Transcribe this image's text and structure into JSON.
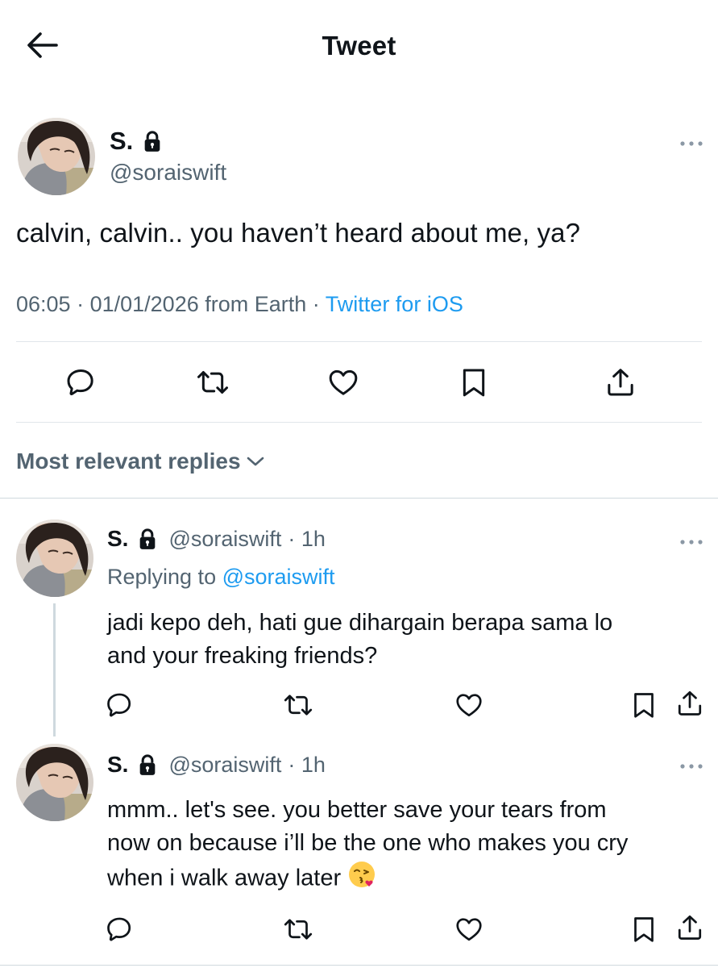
{
  "header": {
    "title": "Tweet",
    "back_icon": "arrow-left-icon"
  },
  "main_tweet": {
    "display_name": "S.",
    "handle": "@soraiswift",
    "text": "calvin, calvin.. you haven’t heard about me, ya?",
    "time": "06:05",
    "date": "01/01/2026 from Earth",
    "source": "Twitter for iOS",
    "actions": [
      "reply-icon",
      "retweet-icon",
      "like-icon",
      "bookmark-icon",
      "share-icon"
    ]
  },
  "replies_section": {
    "sort_label": "Most relevant replies"
  },
  "replies": [
    {
      "display_name": "S.",
      "handle": "@soraiswift",
      "time": "· 1h",
      "replying_to_label": "Replying to",
      "replying_to_handle": "@soraiswift",
      "text_line1": "jadi kepo deh, hati gue dihargain berapa sama lo",
      "text_line2": "and your freaking friends?"
    },
    {
      "display_name": "S.",
      "handle": "@soraiswift",
      "time": "· 1h",
      "text_line1": "mmm.. let's see. you better save your tears from",
      "text_line2": "now on because i’ll be the one who makes you cry",
      "text_line3": "when i walk away later",
      "emoji": "😘"
    }
  ],
  "colors": {
    "text": "#0f1419",
    "secondary": "#536471",
    "accent": "#1d9bf0",
    "divider": "#e1e6ea"
  }
}
